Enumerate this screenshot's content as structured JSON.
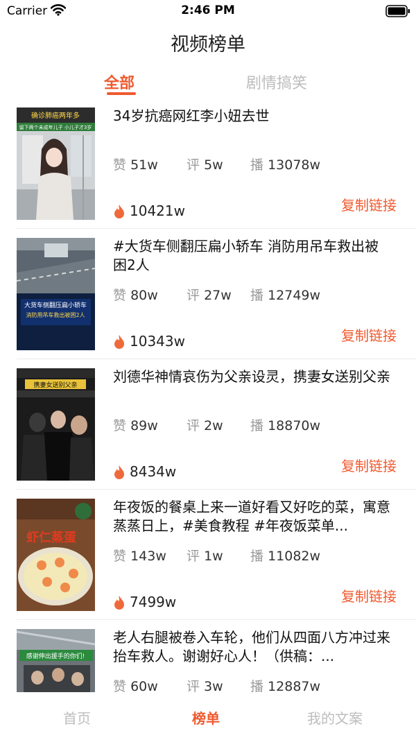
{
  "status": {
    "carrier": "Carrier",
    "time": "2:46 PM"
  },
  "nav": {
    "title": "视频榜单"
  },
  "tabs": [
    {
      "label": "全部",
      "active": true
    },
    {
      "label": "剧情搞笑",
      "active": false
    }
  ],
  "items": [
    {
      "title": "34岁抗癌网红李小妞去世",
      "likes_prefix": "赞",
      "likes": "51w",
      "comments_prefix": "评",
      "comments": "5w",
      "plays_prefix": "播",
      "plays": "13078w",
      "hot": "10421w",
      "copy_label": "复制链接",
      "thumb": {
        "caption_top": "确诊肺癌两年多",
        "caption_sub": "留下两个未成年儿子 小儿子才3岁"
      }
    },
    {
      "title": "#大货车侧翻压扁小轿车 消防用吊车救出被困2人",
      "likes_prefix": "赞",
      "likes": "80w",
      "comments_prefix": "评",
      "comments": "27w",
      "plays_prefix": "播",
      "plays": "12749w",
      "hot": "10343w",
      "copy_label": "复制链接",
      "thumb": {
        "caption_top": "大货车侧翻压扁小轿车",
        "caption_sub": "消防用吊车救出被困2人"
      }
    },
    {
      "title": "刘德华神情哀伤为父亲设灵，携妻女送别父亲",
      "likes_prefix": "赞",
      "likes": "89w",
      "comments_prefix": "评",
      "comments": "2w",
      "plays_prefix": "播",
      "plays": "18870w",
      "hot": "8434w",
      "copy_label": "复制链接",
      "thumb": {
        "caption_top": "携妻女送别父亲",
        "caption_sub": ""
      }
    },
    {
      "title": "年夜饭的餐桌上来一道好看又好吃的菜，寓意蒸蒸日上，#美食教程 #年夜饭菜单...",
      "likes_prefix": "赞",
      "likes": "143w",
      "comments_prefix": "评",
      "comments": "1w",
      "plays_prefix": "播",
      "plays": "11082w",
      "hot": "7499w",
      "copy_label": "复制链接",
      "thumb": {
        "caption_top": "虾仁蒸蛋",
        "caption_sub": ""
      }
    },
    {
      "title": "老人右腿被卷入车轮，他们从四面八方冲过来抬车救人。谢谢好心人！（供稿：...",
      "likes_prefix": "赞",
      "likes": "60w",
      "comments_prefix": "评",
      "comments": "3w",
      "plays_prefix": "播",
      "plays": "12887w",
      "hot": "",
      "copy_label": "复制链接",
      "thumb": {
        "caption_top": "感谢伸出援手的你们!",
        "caption_sub": ""
      }
    }
  ],
  "tabbar": [
    {
      "label": "首页",
      "active": false
    },
    {
      "label": "榜单",
      "active": true
    },
    {
      "label": "我的文案",
      "active": false
    }
  ],
  "colors": {
    "accent": "#ef5a2f",
    "inactive": "#bdbdbd"
  }
}
